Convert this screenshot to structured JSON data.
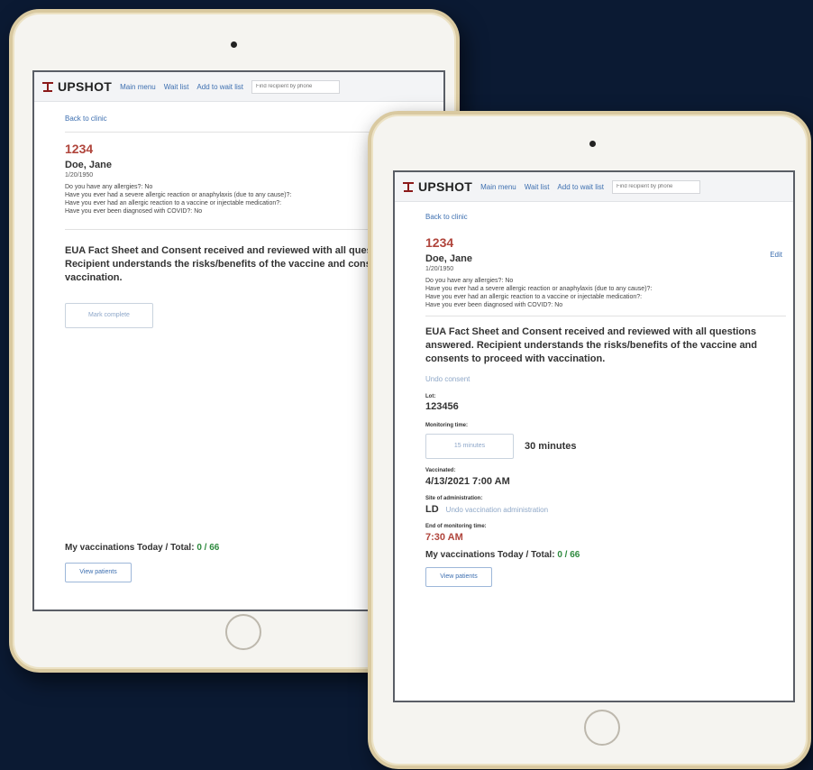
{
  "nav": {
    "logo": "UPSHOT",
    "main_menu": "Main menu",
    "wait_list": "Wait list",
    "add_to_wait_list": "Add to wait list",
    "search_placeholder": "Find recipient by phone"
  },
  "back_link": "Back to clinic",
  "edit_link": "Edit",
  "recipient": {
    "id": "1234",
    "name": "Doe, Jane",
    "dob": "1/20/1950",
    "questions": [
      "Do you have any allergies?: No",
      "Have you ever had a severe allergic reaction or anaphylaxis (due to any cause)?:",
      "Have you ever had an allergic reaction to a vaccine or injectable medication?:",
      "Have you ever been diagnosed with COVID?: No"
    ]
  },
  "consent_text": "EUA Fact Sheet and Consent received and reviewed with all questions answered. Recipient understands the risks/benefits of the vaccine and consents to proceed with vaccination.",
  "mark_complete": "Mark complete",
  "undo_consent": "Undo consent",
  "lot": {
    "label": "Lot:",
    "value": "123456"
  },
  "monitoring": {
    "label": "Monitoring time:",
    "button": "15 minutes",
    "selected": "30 minutes"
  },
  "vaccinated": {
    "label": "Vaccinated:",
    "value": "4/13/2021 7:00 AM"
  },
  "site": {
    "label": "Site of administration:",
    "value": "LD",
    "undo": "Undo vaccination administration"
  },
  "end_monitoring": {
    "label": "End of monitoring time:",
    "value": "7:30 AM"
  },
  "totals": {
    "label": "My vaccinations Today / Total:",
    "count": "0 / 66"
  },
  "view_patients": "View patients",
  "colors": {
    "accent": "#3d6fb0",
    "id_red": "#b0453c",
    "count_green": "#2e8a3e",
    "background": "#0b1a33"
  }
}
